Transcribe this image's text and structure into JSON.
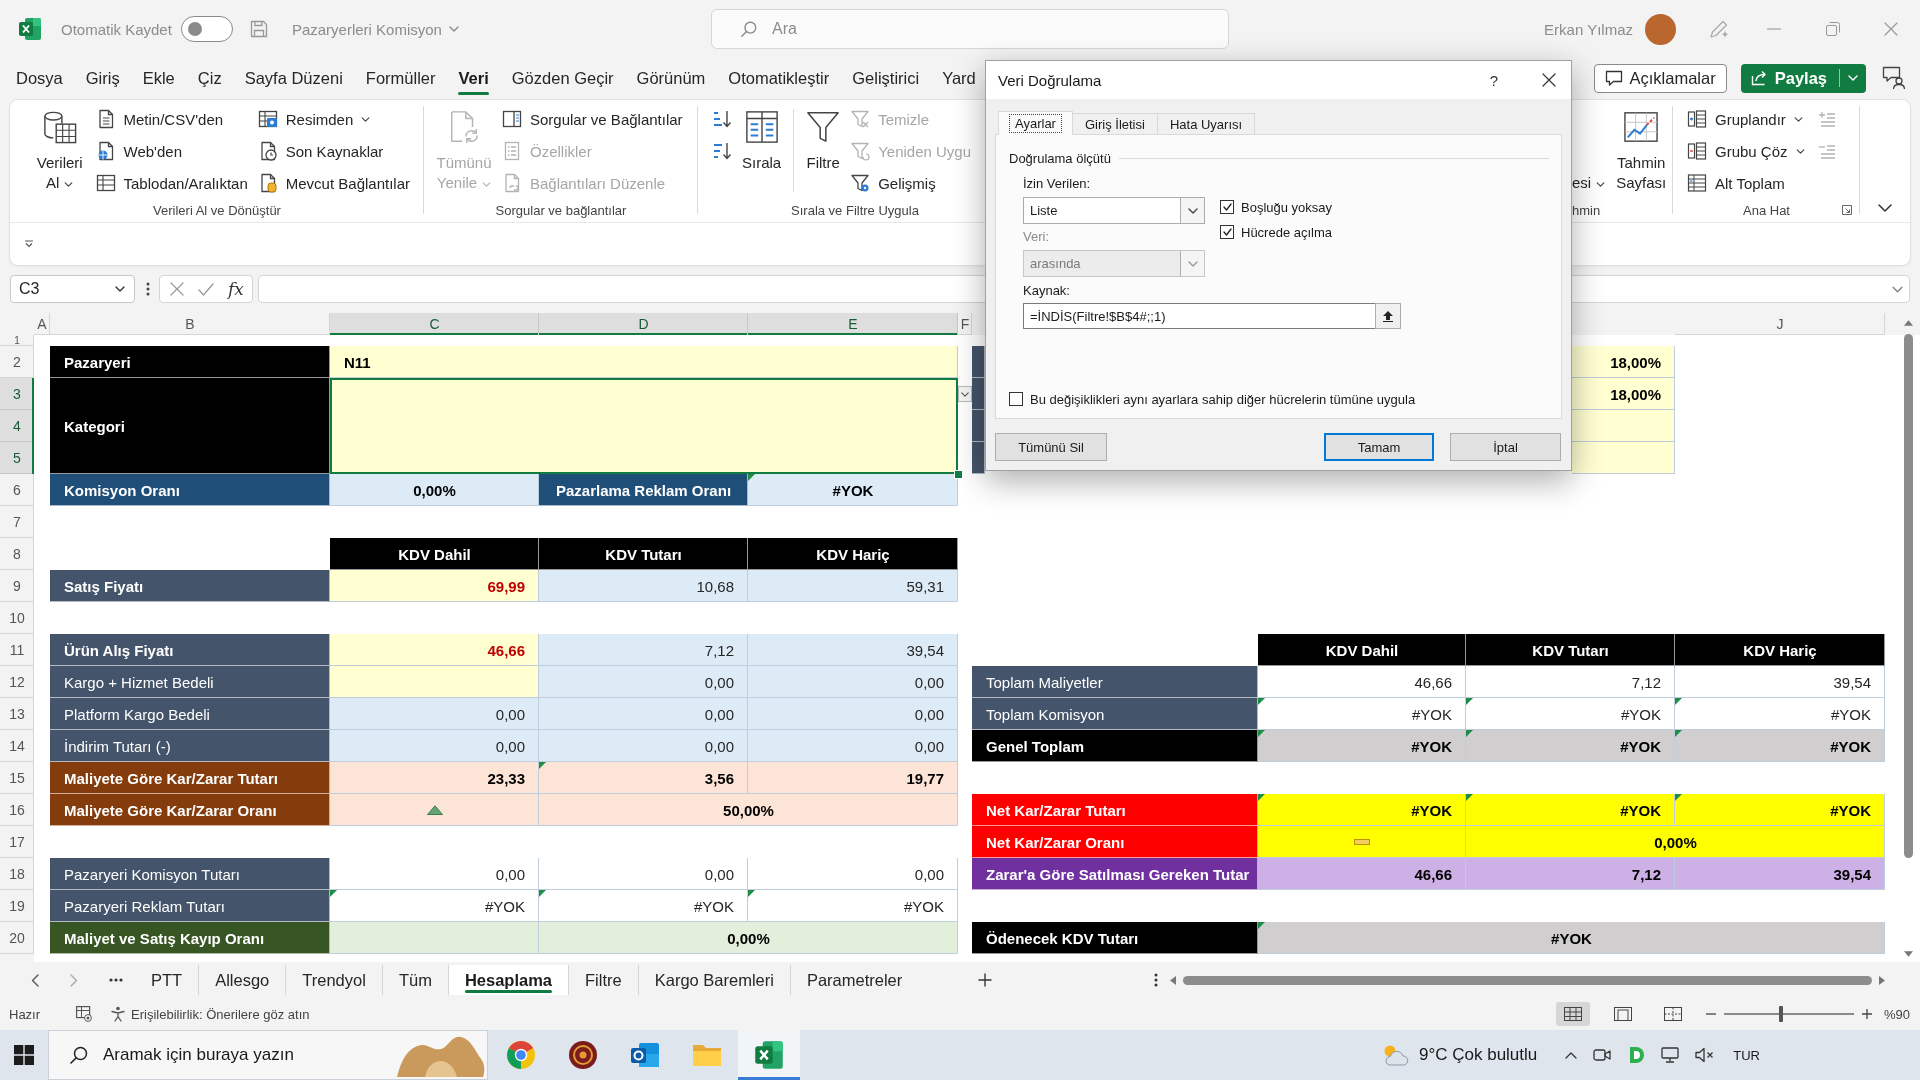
{
  "title_bar": {
    "autosave_label": "Otomatik Kaydet",
    "autosave_on": false,
    "file_name": "Pazaryerleri Komisyon",
    "search_placeholder": "Ara",
    "user_name": "Erkan Yılmaz"
  },
  "menu": {
    "tabs": [
      {
        "label": "Dosya",
        "selected": false
      },
      {
        "label": "Giriş",
        "selected": false
      },
      {
        "label": "Ekle",
        "selected": false
      },
      {
        "label": "Çiz",
        "selected": false
      },
      {
        "label": "Sayfa Düzeni",
        "selected": false
      },
      {
        "label": "Formüller",
        "selected": false
      },
      {
        "label": "Veri",
        "selected": true
      },
      {
        "label": "Gözden Geçir",
        "selected": false
      },
      {
        "label": "Görünüm",
        "selected": false
      },
      {
        "label": "Otomatikleştir",
        "selected": false
      },
      {
        "label": "Geliştirici",
        "selected": false
      },
      {
        "label": "Yard",
        "selected": false
      }
    ],
    "comments_button": "Açıklamalar",
    "share_button": "Paylaş"
  },
  "ribbon": {
    "groups": [
      {
        "label": "Verileri Al ve Dönüştür",
        "launcher": false,
        "controls": [
          {
            "kind": "large",
            "label": "Verileri Al",
            "dropdown": true,
            "disabled": false
          },
          {
            "kind": "stack",
            "buttons": [
              {
                "label": "Metin/CSV'den",
                "dropdown": false,
                "disabled": false
              },
              {
                "label": "Web'den",
                "dropdown": false,
                "disabled": false
              },
              {
                "label": "Tablodan/Aralıktan",
                "dropdown": false,
                "disabled": false
              }
            ]
          },
          {
            "kind": "stack",
            "buttons": [
              {
                "label": "Resimden",
                "dropdown": true,
                "disabled": false
              },
              {
                "label": "Son Kaynaklar",
                "dropdown": false,
                "disabled": false
              },
              {
                "label": "Mevcut Bağlantılar",
                "dropdown": false,
                "disabled": false
              }
            ]
          }
        ]
      },
      {
        "label": "Sorgular ve bağlantılar",
        "launcher": false,
        "controls": [
          {
            "kind": "large",
            "label": "Tümünü Yenile",
            "dropdown": true,
            "disabled": true
          },
          {
            "kind": "stack",
            "buttons": [
              {
                "label": "Sorgular ve Bağlantılar",
                "dropdown": false,
                "disabled": false
              },
              {
                "label": "Özellikler",
                "dropdown": false,
                "disabled": true
              },
              {
                "label": "Bağlantıları Düzenle",
                "dropdown": false,
                "disabled": true
              }
            ]
          }
        ]
      },
      {
        "label": "Sırala ve Filtre Uygula",
        "launcher": false,
        "controls": [
          {
            "kind": "stack",
            "buttons": [
              {
                "dropdown": false,
                "disabled": false
              },
              {
                "dropdown": false,
                "disabled": false
              }
            ]
          },
          {
            "kind": "large",
            "label": "Sırala",
            "dropdown": false,
            "disabled": false
          },
          {
            "kind": "separator"
          },
          {
            "kind": "large",
            "label": "Filtre",
            "dropdown": false,
            "disabled": false
          },
          {
            "kind": "stack",
            "buttons": [
              {
                "label": "Temizle",
                "dropdown": false,
                "disabled": true
              },
              {
                "label": "Yeniden Uygu",
                "dropdown": false,
                "disabled": true
              },
              {
                "label": "Gelişmiş",
                "dropdown": false,
                "disabled": false
              }
            ]
          }
        ]
      },
      {
        "label": "hmin",
        "launcher": false,
        "controls": [
          {
            "kind": "large",
            "label": "esi",
            "dropdown": true,
            "disabled": false
          },
          {
            "kind": "large",
            "label": "Tahmin Sayfası",
            "dropdown": false,
            "disabled": false
          }
        ]
      },
      {
        "label": "Ana Hat",
        "launcher": true,
        "controls": [
          {
            "kind": "stack",
            "buttons": [
              {
                "label": "Gruplandır",
                "dropdown": true,
                "disabled": false
              },
              {
                "label": "Grubu Çöz",
                "dropdown": true,
                "disabled": false
              },
              {
                "label": "Alt Toplam",
                "dropdown": false,
                "disabled": false
              }
            ]
          },
          {
            "kind": "stack",
            "buttons": [
              {
                "dropdown": false,
                "disabled": true
              },
              {
                "dropdown": false,
                "disabled": true
              }
            ]
          }
        ]
      }
    ]
  },
  "formula_bar": {
    "name_box": "C3",
    "function_button": "fx"
  },
  "sheet": {
    "columns": [
      {
        "label": "A",
        "selected": false
      },
      {
        "label": "B",
        "selected": false
      },
      {
        "label": "C",
        "selected": true
      },
      {
        "label": "D",
        "selected": true
      },
      {
        "label": "E",
        "selected": true
      },
      {
        "label": "F",
        "selected": false
      },
      {
        "label": "J",
        "selected": false
      }
    ],
    "rows": [
      {
        "label": "1",
        "selected": false
      },
      {
        "label": "2",
        "selected": false
      },
      {
        "label": "3",
        "selected": true
      },
      {
        "label": "4",
        "selected": true
      },
      {
        "label": "5",
        "selected": true
      },
      {
        "label": "6",
        "selected": false
      },
      {
        "label": "7",
        "selected": false
      },
      {
        "label": "8",
        "selected": false
      },
      {
        "label": "9",
        "selected": false
      },
      {
        "label": "10",
        "selected": false
      },
      {
        "label": "11",
        "selected": false
      },
      {
        "label": "12",
        "selected": false
      },
      {
        "label": "13",
        "selected": false
      },
      {
        "label": "14",
        "selected": false
      },
      {
        "label": "15",
        "selected": false
      },
      {
        "label": "16",
        "selected": false
      },
      {
        "label": "17",
        "selected": false
      },
      {
        "label": "18",
        "selected": false
      },
      {
        "label": "19",
        "selected": false
      },
      {
        "label": "20",
        "selected": false
      }
    ],
    "tables": [
      {
        "rows": [
          {
            "kind": "single",
            "cells": [
              {
                "kind": "title",
                "text": "Pazaryeri",
                "flag": false,
                "selected": false
              },
              {
                "kind": "name_input",
                "text": "N11",
                "flag": false,
                "selected": false
              }
            ]
          },
          {
            "kind": "tall",
            "cells": [
              {
                "kind": "title",
                "text": "Kategori",
                "flag": false,
                "selected": false
              },
              {
                "kind": "name_input",
                "flag": false,
                "selected": true
              }
            ]
          },
          {
            "kind": "single",
            "cells": [
              {
                "kind": "rate_label",
                "text": "Komisyon Oranı",
                "flag": false,
                "selected": false
              },
              {
                "kind": "rate",
                "text": "0,00%",
                "flag": false,
                "selected": false
              },
              {
                "kind": "rate_label",
                "text": "Pazarlama Reklam Oranı",
                "flag": false,
                "selected": false
              },
              {
                "kind": "rate",
                "text": "#YOK",
                "flag": true,
                "selected": false
              }
            ]
          }
        ]
      },
      {
        "rows": [
          {
            "cells": [
              {
                "kind": "column_header",
                "text": "KDV Dahil",
                "flag": false,
                "selected": false
              },
              {
                "kind": "column_header",
                "text": "KDV Tutarı",
                "flag": false,
                "selected": false
              },
              {
                "kind": "column_header",
                "text": "KDV Hariç",
                "flag": false,
                "selected": false
              }
            ]
          }
        ]
      },
      {
        "rows": [
          {
            "cells": [
              {
                "kind": "key_label",
                "text": "Satış Fiyatı",
                "flag": false,
                "selected": false
              },
              {
                "kind": "price_input",
                "text": "69,99",
                "flag": false,
                "selected": false
              },
              {
                "kind": "calc",
                "text": "10,68",
                "flag": false,
                "selected": false
              },
              {
                "kind": "calc",
                "text": "59,31",
                "flag": false,
                "selected": false
              }
            ]
          }
        ]
      },
      {
        "rows": [
          {
            "cells": [
              {
                "kind": "key_label",
                "text": "Ürün Alış Fiyatı",
                "flag": false,
                "selected": false
              },
              {
                "kind": "price_input",
                "text": "46,66",
                "flag": false,
                "selected": false
              },
              {
                "kind": "calc",
                "text": "7,12",
                "flag": false,
                "selected": false
              },
              {
                "kind": "calc",
                "text": "39,54",
                "flag": false,
                "selected": false
              }
            ]
          },
          {
            "cells": [
              {
                "kind": "item_label",
                "text": "Kargo + Hizmet Bedeli",
                "flag": false,
                "selected": false
              },
              {
                "kind": "price_input",
                "flag": false,
                "selected": false
              },
              {
                "kind": "calc",
                "text": "0,00",
                "flag": false,
                "selected": false
              },
              {
                "kind": "calc",
                "text": "0,00",
                "flag": false,
                "selected": false
              }
            ]
          },
          {
            "cells": [
              {
                "kind": "item_label",
                "text": "Platform Kargo Bedeli",
                "flag": false,
                "selected": false
              },
              {
                "kind": "calc",
                "text": "0,00",
                "flag": false,
                "selected": false
              },
              {
                "kind": "calc",
                "text": "0,00",
                "flag": false,
                "selected": false
              },
              {
                "kind": "calc",
                "text": "0,00",
                "flag": false,
                "selected": false
              }
            ]
          },
          {
            "cells": [
              {
                "kind": "item_label",
                "text": "İndirim Tutarı (-)",
                "flag": false,
                "selected": false
              },
              {
                "kind": "calc",
                "text": "0,00",
                "flag": false,
                "selected": false
              },
              {
                "kind": "calc",
                "text": "0,00",
                "flag": false,
                "selected": false
              },
              {
                "kind": "calc",
                "text": "0,00",
                "flag": false,
                "selected": false
              }
            ]
          },
          {
            "cells": [
              {
                "kind": "profit_label",
                "text": "Maliyete Göre Kar/Zarar Tutarı",
                "flag": false,
                "selected": false
              },
              {
                "kind": "profit",
                "text": "23,33",
                "flag": false,
                "selected": false
              },
              {
                "kind": "profit",
                "text": "3,56",
                "flag": true,
                "selected": false
              },
              {
                "kind": "profit",
                "text": "19,77",
                "flag": false,
                "selected": false
              }
            ]
          },
          {
            "cells": [
              {
                "kind": "profit_label",
                "text": "Maliyete Göre Kar/Zarar Oranı",
                "flag": false,
                "selected": false
              },
              {
                "kind": "profit_up",
                "flag": false,
                "selected": false
              },
              {
                "kind": "profit",
                "text": "50,00%",
                "flag": false,
                "selected": false
              }
            ]
          }
        ]
      },
      {
        "rows": [
          {
            "cells": [
              {
                "kind": "item_label",
                "text": "Pazaryeri Komisyon Tutarı",
                "flag": false,
                "selected": false
              },
              {
                "kind": "plain",
                "text": "0,00",
                "flag": false,
                "selected": false
              },
              {
                "kind": "plain",
                "text": "0,00",
                "flag": false,
                "selected": false
              },
              {
                "kind": "plain",
                "text": "0,00",
                "flag": false,
                "selected": false
              }
            ]
          },
          {
            "cells": [
              {
                "kind": "item_label",
                "text": "Pazaryeri Reklam Tutarı",
                "flag": false,
                "selected": false
              },
              {
                "kind": "plain",
                "text": "#YOK",
                "flag": true,
                "selected": false
              },
              {
                "kind": "plain",
                "text": "#YOK",
                "flag": true,
                "selected": false
              },
              {
                "kind": "plain",
                "text": "#YOK",
                "flag": true,
                "selected": false
              }
            ]
          },
          {
            "cells": [
              {
                "kind": "loss_label",
                "text": "Maliyet ve Satış Kayıp Oranı",
                "flag": false,
                "selected": false
              },
              {
                "kind": "loss",
                "flag": false,
                "selected": false
              },
              {
                "kind": "loss",
                "text": "0,00%",
                "flag": false,
                "selected": false
              }
            ]
          }
        ]
      },
      {
        "rows": [
          {
            "cells": [
              {
                "kind": "item_label",
                "flag": false,
                "selected": false
              },
              {
                "kind": "input_bold",
                "text": "18,00%",
                "flag": false,
                "selected": false
              }
            ]
          },
          {
            "cells": [
              {
                "kind": "item_label",
                "flag": false,
                "selected": false
              },
              {
                "kind": "input_bold",
                "text": "18,00%",
                "flag": false,
                "selected": false
              }
            ]
          },
          {
            "cells": [
              {
                "kind": "item_label",
                "flag": false,
                "selected": false
              },
              {
                "kind": "input_bold",
                "flag": false,
                "selected": false
              }
            ]
          },
          {
            "cells": [
              {
                "kind": "item_label",
                "flag": false,
                "selected": false
              },
              {
                "kind": "input_bold",
                "flag": false,
                "selected": false
              }
            ]
          }
        ]
      },
      {
        "rows": [
          {
            "cells": [
              {
                "kind": "column_header",
                "text": "KDV Dahil",
                "flag": false,
                "selected": false
              },
              {
                "kind": "column_header",
                "text": "KDV Tutarı",
                "flag": false,
                "selected": false
              },
              {
                "kind": "column_header",
                "text": "KDV Hariç",
                "flag": false,
                "selected": false
              }
            ]
          }
        ]
      },
      {
        "rows": [
          {
            "cells": [
              {
                "kind": "item_label",
                "text": "Toplam Maliyetler",
                "flag": false,
                "selected": false
              },
              {
                "kind": "plain",
                "text": "46,66",
                "flag": false,
                "selected": false
              },
              {
                "kind": "plain",
                "text": "7,12",
                "flag": false,
                "selected": false
              },
              {
                "kind": "plain",
                "text": "39,54",
                "flag": false,
                "selected": false
              }
            ]
          },
          {
            "cells": [
              {
                "kind": "item_label",
                "text": "Toplam Komisyon",
                "flag": false,
                "selected": false
              },
              {
                "kind": "plain",
                "text": "#YOK",
                "flag": true,
                "selected": false
              },
              {
                "kind": "plain",
                "text": "#YOK",
                "flag": true,
                "selected": false
              },
              {
                "kind": "plain",
                "text": "#YOK",
                "flag": true,
                "selected": false
              }
            ]
          },
          {
            "cells": [
              {
                "kind": "title",
                "text": "Genel Toplam",
                "flag": false,
                "selected": false
              },
              {
                "kind": "total",
                "text": "#YOK",
                "flag": true,
                "selected": false
              },
              {
                "kind": "total",
                "text": "#YOK",
                "flag": true,
                "selected": false
              },
              {
                "kind": "total",
                "text": "#YOK",
                "flag": true,
                "selected": false
              }
            ]
          }
        ]
      },
      {
        "rows": [
          {
            "cells": [
              {
                "kind": "net_label",
                "text": "Net Kar/Zarar Tutarı",
                "flag": false,
                "selected": false
              },
              {
                "kind": "net",
                "text": "#YOK",
                "flag": true,
                "selected": false
              },
              {
                "kind": "net",
                "text": "#YOK",
                "flag": true,
                "selected": false
              },
              {
                "kind": "net",
                "text": "#YOK",
                "flag": true,
                "selected": false
              }
            ]
          },
          {
            "cells": [
              {
                "kind": "net_label",
                "text": "Net Kar/Zarar Oranı",
                "flag": false,
                "selected": false
              },
              {
                "kind": "net_flat",
                "flag": false,
                "selected": false
              },
              {
                "kind": "net",
                "text": "0,00%",
                "flag": false,
                "selected": false
              }
            ]
          },
          {
            "cells": [
              {
                "kind": "target_label",
                "text": "Zarar'a Göre Satılması Gereken Tutar",
                "flag": false,
                "selected": false
              },
              {
                "kind": "target",
                "text": "46,66",
                "flag": false,
                "selected": false
              },
              {
                "kind": "target",
                "text": "7,12",
                "flag": false,
                "selected": false
              },
              {
                "kind": "target",
                "text": "39,54",
                "flag": false,
                "selected": false
              }
            ]
          }
        ]
      },
      {
        "rows": [
          {
            "cells": [
              {
                "kind": "title",
                "text": "Ödenecek KDV Tutarı",
                "flag": false,
                "selected": false
              },
              {
                "kind": "total",
                "text": "#YOK",
                "flag": true,
                "selected": false
              }
            ]
          }
        ]
      }
    ]
  },
  "dialog": {
    "title": "Veri Doğrulama",
    "help": "?",
    "tabs": [
      {
        "label": "Ayarlar",
        "selected": true
      },
      {
        "label": "Giriş İletisi",
        "selected": false
      },
      {
        "label": "Hata Uyarısı",
        "selected": false
      }
    ],
    "section": "Doğrulama ölçütü",
    "allow": {
      "label": "İzin Verilen:",
      "value": "Liste",
      "disabled": false
    },
    "data": {
      "label": "Veri:",
      "value": "arasında",
      "disabled": true
    },
    "checkboxes": [
      {
        "label": "Boşluğu yoksay",
        "checked": true
      },
      {
        "label": "Hücrede açılma",
        "checked": true
      }
    ],
    "source": {
      "label": "Kaynak:",
      "value": "=İNDİS(Filtre!$B$4#;;1)"
    },
    "apply_all": {
      "label": "Bu değişiklikleri aynı ayarlara sahip diğer hücrelerin tümüne uygula",
      "checked": false
    },
    "buttons": [
      {
        "label": "Tümünü Sil",
        "default": false
      },
      {
        "label": "Tamam",
        "default": true
      },
      {
        "label": "İptal",
        "default": false
      }
    ]
  },
  "sheet_tabs": {
    "tabs": [
      {
        "label": "PTT",
        "selected": false
      },
      {
        "label": "Allesgo",
        "selected": false
      },
      {
        "label": "Trendyol",
        "selected": false
      },
      {
        "label": "Tüm",
        "selected": false
      },
      {
        "label": "Hesaplama",
        "selected": true
      },
      {
        "label": "Filtre",
        "selected": false
      },
      {
        "label": "Kargo Baremleri",
        "selected": false
      },
      {
        "label": "Parametreler",
        "selected": false
      }
    ]
  },
  "status_bar": {
    "status": "Hazır",
    "accessibility": "Erişilebilirlik: Önerilere göz atın",
    "views": [
      {
        "selected": true
      },
      {
        "selected": false
      },
      {
        "selected": false
      }
    ],
    "zoom": {
      "level": 0.44,
      "reading": "%90"
    }
  },
  "taskbar": {
    "search_placeholder": "Aramak için buraya yazın",
    "apps": [
      {
        "active": false
      },
      {
        "active": false
      },
      {
        "active": false
      },
      {
        "active": false
      },
      {
        "active": true
      }
    ],
    "weather": "9°C Çok bulutlu",
    "language": "TUR"
  }
}
